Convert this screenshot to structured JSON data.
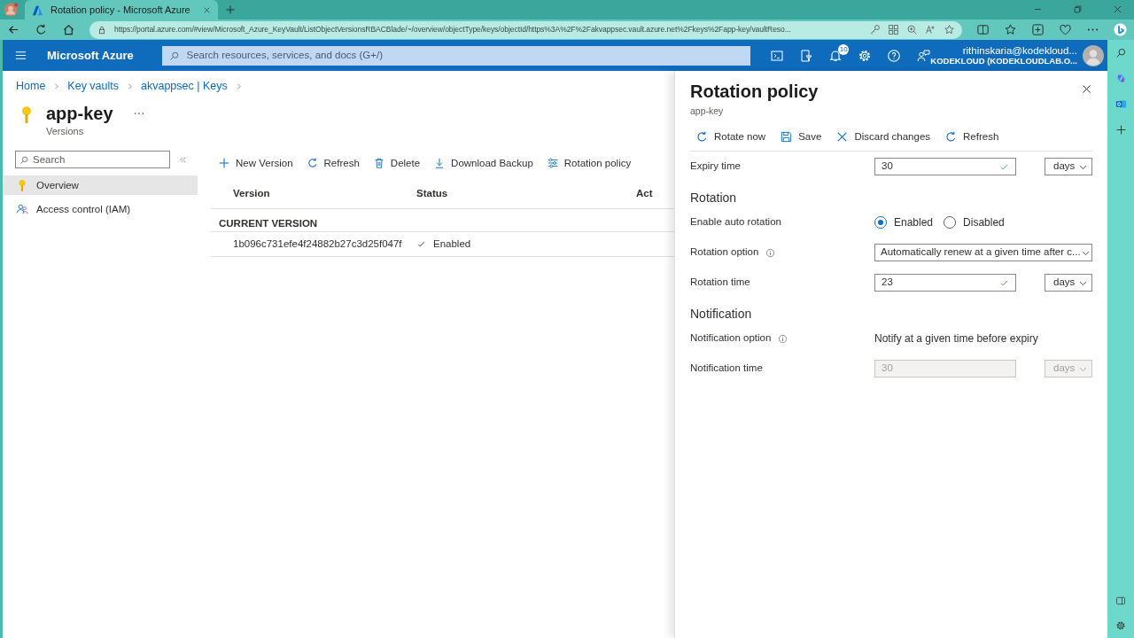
{
  "browser": {
    "tab_title": "Rotation policy - Microsoft Azure",
    "url": "https://portal.azure.com/#view/Microsoft_Azure_KeyVault/ListObjectVersionsRBACBlade/~/overview/objectType/keys/objectId/https%3A%2F%2Fakvappsec.vault.azure.net%2Fkeys%2Fapp-key/vaultReso..."
  },
  "header": {
    "brand": "Microsoft Azure",
    "search_placeholder": "Search resources, services, and docs (G+/)",
    "notification_count": "10",
    "user_name": "rithinskaria@kodekloud...",
    "user_tenant": "KODEKLOUD (KODEKLOUDLAB.O..."
  },
  "breadcrumb": [
    "Home",
    "Key vaults",
    "akvappsec | Keys"
  ],
  "resource": {
    "title": "app-key",
    "subtitle": "Versions"
  },
  "sidebar": {
    "search_placeholder": "Search",
    "items": [
      {
        "label": "Overview",
        "kind": "key",
        "selected": true
      },
      {
        "label": "Access control (IAM)",
        "kind": "people",
        "selected": false
      }
    ]
  },
  "toolbar": [
    {
      "label": "New Version",
      "kind": "plus"
    },
    {
      "label": "Refresh",
      "kind": "refresh"
    },
    {
      "label": "Delete",
      "kind": "trash"
    },
    {
      "label": "Download Backup",
      "kind": "download"
    },
    {
      "label": "Rotation policy",
      "kind": "sliders"
    }
  ],
  "table": {
    "columns": [
      "Version",
      "Status",
      "Act"
    ],
    "group": "CURRENT VERSION",
    "rows": [
      {
        "version": "1b096c731efe4f24882b27c3d25f047f",
        "status": "Enabled"
      }
    ]
  },
  "panel": {
    "title": "Rotation policy",
    "subtitle": "app-key",
    "toolbar": [
      {
        "label": "Rotate now",
        "kind": "refresh"
      },
      {
        "label": "Save",
        "kind": "save"
      },
      {
        "label": "Discard changes",
        "kind": "close"
      },
      {
        "label": "Refresh",
        "kind": "refresh"
      }
    ],
    "rows": [
      {
        "kind": "number",
        "label": "Expiry time",
        "value": "30",
        "unit": "days",
        "disabled": false
      },
      {
        "kind": "heading",
        "label": "Rotation"
      },
      {
        "kind": "radio",
        "label": "Enable auto rotation",
        "options": [
          {
            "label": "Enabled",
            "selected": true
          },
          {
            "label": "Disabled",
            "selected": false
          }
        ]
      },
      {
        "kind": "select",
        "label": "Rotation option",
        "info": true,
        "value": "Automatically renew at a given time after c..."
      },
      {
        "kind": "number",
        "label": "Rotation time",
        "value": "23",
        "unit": "days",
        "disabled": false
      },
      {
        "kind": "heading",
        "label": "Notification"
      },
      {
        "kind": "text",
        "label": "Notification option",
        "info": true,
        "value": "Notify at a given time before expiry"
      },
      {
        "kind": "number",
        "label": "Notification time",
        "value": "30",
        "unit": "days",
        "disabled": true
      }
    ]
  }
}
